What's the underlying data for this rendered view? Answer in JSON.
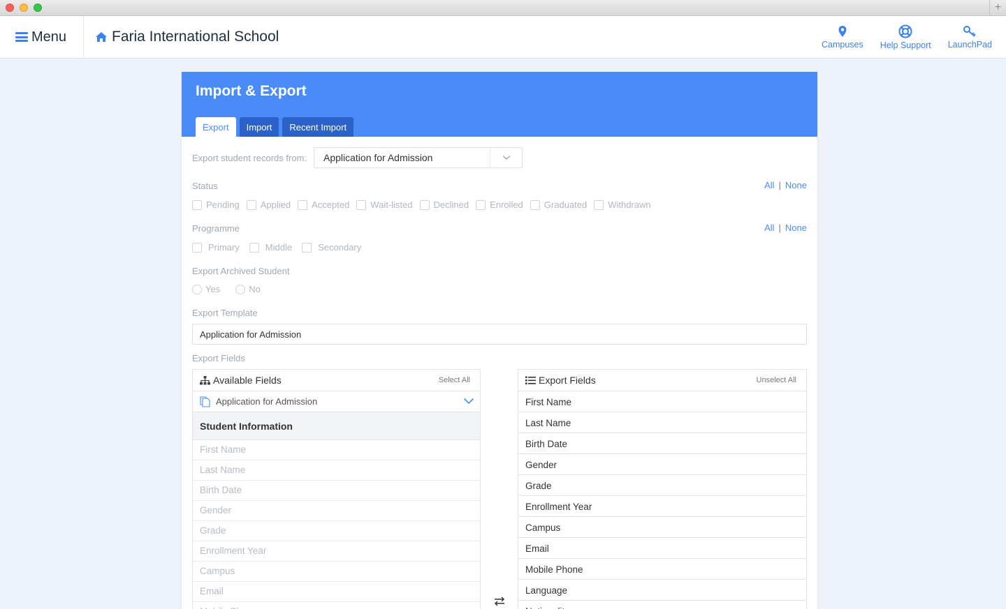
{
  "window": {
    "new_tab_glyph": "+"
  },
  "navbar": {
    "menu_label": "Menu",
    "school_name": "Faria International School",
    "links": [
      {
        "label": "Campuses",
        "icon": "map-pin-icon"
      },
      {
        "label": "Help Support",
        "icon": "lifebuoy-icon"
      },
      {
        "label": "LaunchPad",
        "icon": "key-icon"
      }
    ]
  },
  "colors": {
    "accent": "#4a8cf7",
    "tab_inactive": "#2a62c9"
  },
  "card": {
    "title": "Import & Export",
    "tabs": [
      {
        "label": "Export",
        "active": true
      },
      {
        "label": "Import",
        "active": false
      },
      {
        "label": "Recent Import",
        "active": false
      }
    ]
  },
  "export_form": {
    "records_from_label": "Export student records from:",
    "records_from_value": "Application for Admission",
    "status": {
      "label": "Status",
      "all": "All",
      "sep": "|",
      "none": "None",
      "options": [
        "Pending",
        "Applied",
        "Accepted",
        "Wait-listed",
        "Declined",
        "Enrolled",
        "Graduated",
        "Withdrawn"
      ]
    },
    "programme": {
      "label": "Programme",
      "all": "All",
      "sep": "|",
      "none": "None",
      "options": [
        "Primary",
        "Middle",
        "Secondary"
      ]
    },
    "archived": {
      "label": "Export Archived Student",
      "options": [
        "Yes",
        "No"
      ]
    },
    "template": {
      "label": "Export Template",
      "value": "Application for Admission"
    },
    "fields_label": "Export Fields"
  },
  "available_fields": {
    "title": "Available Fields",
    "action": "Select All",
    "source": "Application for Admission",
    "group": "Student Information",
    "items": [
      "First Name",
      "Last Name",
      "Birth Date",
      "Gender",
      "Grade",
      "Enrollment Year",
      "Campus",
      "Email",
      "Mobile Phone"
    ]
  },
  "export_fields": {
    "title": "Export Fields",
    "action": "Unselect All",
    "items": [
      "First Name",
      "Last Name",
      "Birth Date",
      "Gender",
      "Grade",
      "Enrollment Year",
      "Campus",
      "Email",
      "Mobile Phone",
      "Language",
      "Nationality"
    ]
  }
}
